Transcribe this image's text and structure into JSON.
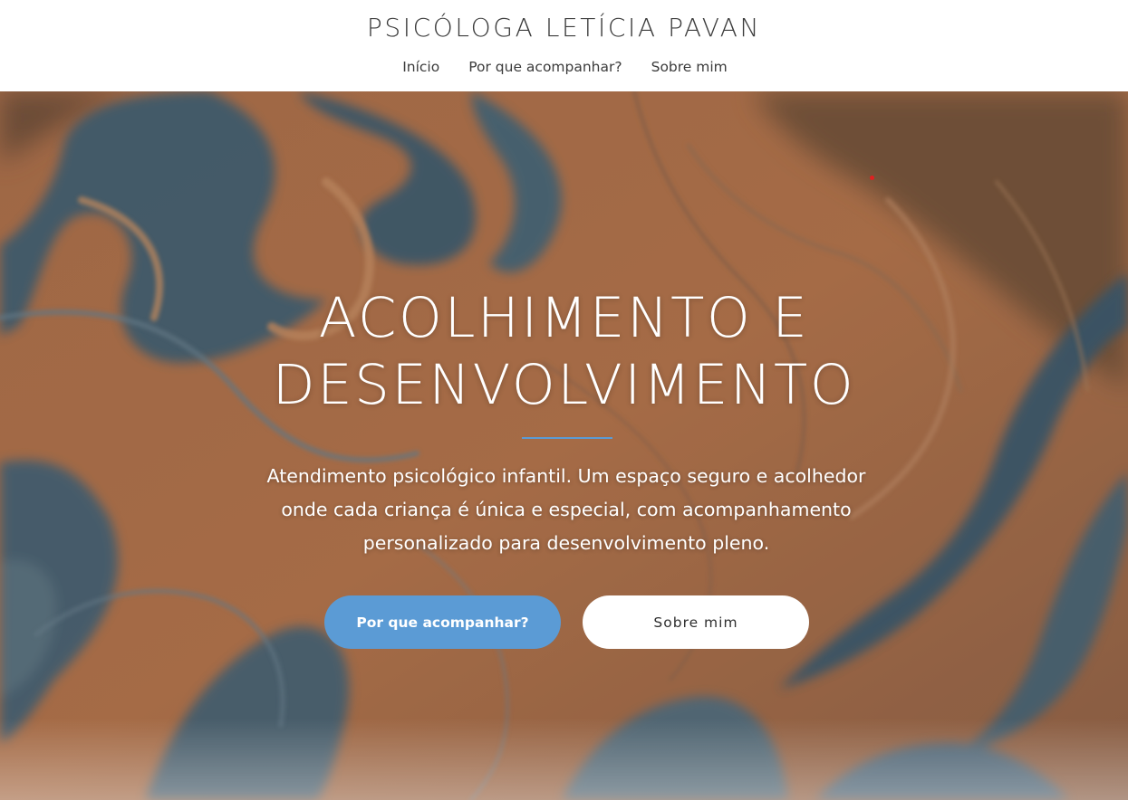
{
  "site": {
    "title": "PSICÓLOGA LETÍCIA PAVAN"
  },
  "nav": {
    "items": [
      {
        "label": "Início"
      },
      {
        "label": "Por que acompanhar?"
      },
      {
        "label": "Sobre mim"
      }
    ]
  },
  "hero": {
    "heading_line1": "ACOLHIMENTO E",
    "heading_line2": "DESENVOLVIMENTO",
    "text_line1": "Atendimento psicológico infantil. Um espaço seguro e acolhedor",
    "text_line2": "onde cada criança é única e especial, com acompanhamento",
    "text_line3": "personalizado para desenvolvimento pleno.",
    "primary_button": "Por que acompanhar?",
    "secondary_button": "Sobre mim",
    "background_image": "abstract-fluid-marble-blue-orange"
  },
  "colors": {
    "accent": "#5b9bd5",
    "header_bg": "#ffffff",
    "text_dark": "#3c3c3c",
    "hero_text": "#ffffff",
    "marble_orange": "#c47a4c",
    "marble_blue": "#3f6478"
  }
}
